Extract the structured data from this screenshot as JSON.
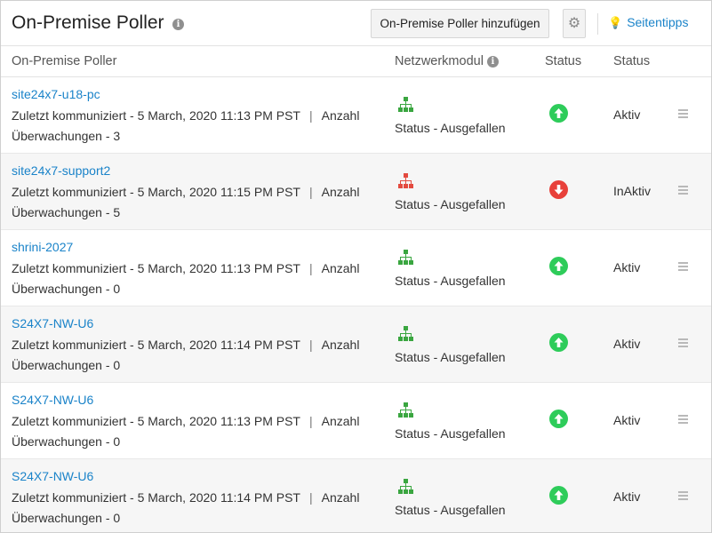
{
  "header": {
    "title": "On-Premise Poller",
    "add_button": "On-Premise Poller hinzufügen",
    "tips_label": "Seitentipps"
  },
  "columns": {
    "poller": "On-Premise Poller",
    "network": "Netzwerkmodul",
    "status1": "Status",
    "status2": "Status"
  },
  "colors": {
    "link": "#1a83c9",
    "up": "#2ecc5a",
    "down": "#e8403a",
    "net_ok": "#3aa640",
    "net_down": "#e34a3f"
  },
  "rows": [
    {
      "name": "site24x7-u18-pc",
      "last": "Zuletzt kommuniziert - 5 March, 2020 11:13 PM PST",
      "count_label": "Anzahl",
      "monitors": "Überwachungen - 3",
      "network_icon": "network-ok-icon",
      "network_status": "Status - Ausgefallen",
      "status_icon": "status-up-icon",
      "status": "Aktiv"
    },
    {
      "name": "site24x7-support2",
      "last": "Zuletzt kommuniziert - 5 March, 2020 11:15 PM PST",
      "count_label": "Anzahl",
      "monitors": "Überwachungen - 5",
      "network_icon": "network-down-icon",
      "network_status": "Status - Ausgefallen",
      "status_icon": "status-down-icon",
      "status": "InAktiv"
    },
    {
      "name": "shrini-2027",
      "last": "Zuletzt kommuniziert - 5 March, 2020 11:13 PM PST",
      "count_label": "Anzahl",
      "monitors": "Überwachungen - 0",
      "network_icon": "network-ok-icon",
      "network_status": "Status - Ausgefallen",
      "status_icon": "status-up-icon",
      "status": "Aktiv"
    },
    {
      "name": "S24X7-NW-U6",
      "last": "Zuletzt kommuniziert - 5 March, 2020 11:14 PM PST",
      "count_label": "Anzahl",
      "monitors": "Überwachungen - 0",
      "network_icon": "network-ok-icon",
      "network_status": "Status - Ausgefallen",
      "status_icon": "status-up-icon",
      "status": "Aktiv"
    },
    {
      "name": "S24X7-NW-U6",
      "last": "Zuletzt kommuniziert - 5 March, 2020 11:13 PM PST",
      "count_label": "Anzahl",
      "monitors": "Überwachungen - 0",
      "network_icon": "network-ok-icon",
      "network_status": "Status - Ausgefallen",
      "status_icon": "status-up-icon",
      "status": "Aktiv"
    },
    {
      "name": "S24X7-NW-U6",
      "last": "Zuletzt kommuniziert - 5 March, 2020 11:14 PM PST",
      "count_label": "Anzahl",
      "monitors": "Überwachungen - 0",
      "network_icon": "network-ok-icon",
      "network_status": "Status - Ausgefallen",
      "status_icon": "status-up-icon",
      "status": "Aktiv"
    }
  ]
}
